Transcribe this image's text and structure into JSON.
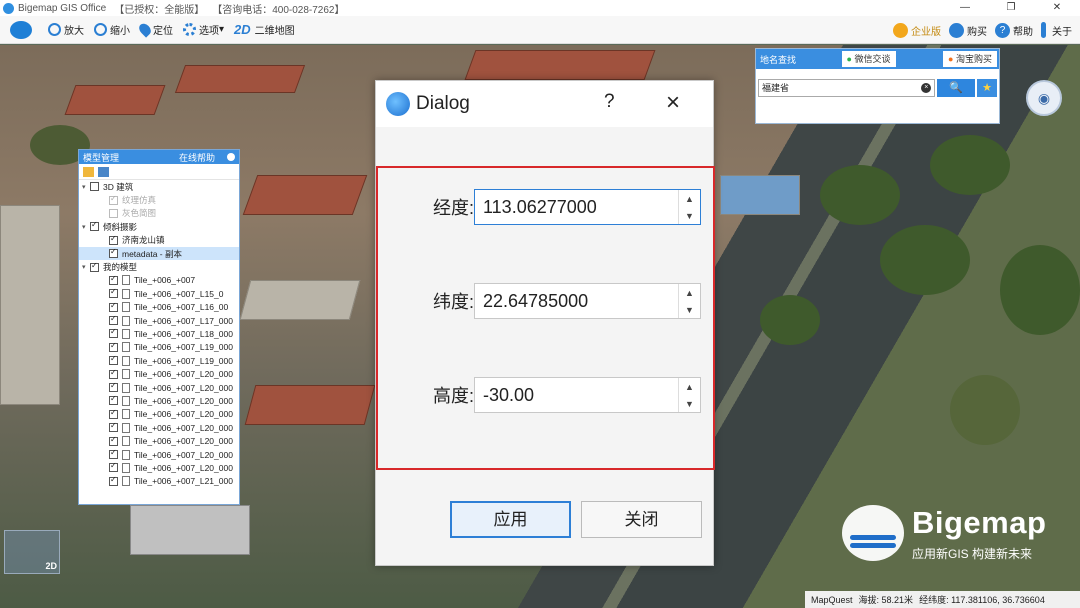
{
  "titlebar": {
    "app": "Bigemap GIS Office",
    "license": "【已授权：全能版】",
    "hotline": "【咨询电话：400-028-7262】"
  },
  "toolbar": {
    "zoom_in": "放大",
    "zoom_out": "缩小",
    "locate": "定位",
    "options": "选项",
    "mode_prefix": "2D",
    "mode": "二维地图",
    "enterprise": "企业版",
    "buy": "购买",
    "help": "帮助",
    "about": "关于"
  },
  "model_panel": {
    "title": "模型管理",
    "online_help": "在线帮助",
    "items": [
      {
        "label": "3D 建筑",
        "level": 0,
        "expanded": true,
        "checked": false,
        "disabled": false
      },
      {
        "label": "纹理仿真",
        "level": 1,
        "checked": true,
        "disabled": true
      },
      {
        "label": "灰色简图",
        "level": 1,
        "checked": false,
        "disabled": true
      },
      {
        "label": "倾斜摄影",
        "level": 0,
        "expanded": true,
        "checked": true,
        "disabled": false
      },
      {
        "label": "济南龙山镇",
        "level": 1,
        "checked": true,
        "disabled": false
      },
      {
        "label": "metadata - 副本",
        "level": 1,
        "checked": true,
        "disabled": false,
        "selected": true
      },
      {
        "label": "我的模型",
        "level": 0,
        "expanded": true,
        "checked": true,
        "disabled": false
      },
      {
        "label": "Tile_+006_+007",
        "level": 1,
        "checked": true,
        "file": true
      },
      {
        "label": "Tile_+006_+007_L15_0",
        "level": 1,
        "checked": true,
        "file": true
      },
      {
        "label": "Tile_+006_+007_L16_00",
        "level": 1,
        "checked": true,
        "file": true
      },
      {
        "label": "Tile_+006_+007_L17_000",
        "level": 1,
        "checked": true,
        "file": true
      },
      {
        "label": "Tile_+006_+007_L18_000",
        "level": 1,
        "checked": true,
        "file": true
      },
      {
        "label": "Tile_+006_+007_L19_000",
        "level": 1,
        "checked": true,
        "file": true
      },
      {
        "label": "Tile_+006_+007_L19_000",
        "level": 1,
        "checked": true,
        "file": true
      },
      {
        "label": "Tile_+006_+007_L20_000",
        "level": 1,
        "checked": true,
        "file": true
      },
      {
        "label": "Tile_+006_+007_L20_000",
        "level": 1,
        "checked": true,
        "file": true
      },
      {
        "label": "Tile_+006_+007_L20_000",
        "level": 1,
        "checked": true,
        "file": true
      },
      {
        "label": "Tile_+006_+007_L20_000",
        "level": 1,
        "checked": true,
        "file": true
      },
      {
        "label": "Tile_+006_+007_L20_000",
        "level": 1,
        "checked": true,
        "file": true
      },
      {
        "label": "Tile_+006_+007_L20_000",
        "level": 1,
        "checked": true,
        "file": true
      },
      {
        "label": "Tile_+006_+007_L20_000",
        "level": 1,
        "checked": true,
        "file": true
      },
      {
        "label": "Tile_+006_+007_L20_000",
        "level": 1,
        "checked": true,
        "file": true
      },
      {
        "label": "Tile_+006_+007_L21_000",
        "level": 1,
        "checked": true,
        "file": true
      }
    ]
  },
  "search_panel": {
    "title": "地名查找",
    "wechat": "微信交谈",
    "taobao": "淘宝购买",
    "query": "福建省",
    "clear": "×",
    "search_icon": "🔍",
    "favorite_icon": "★"
  },
  "dialog": {
    "title": "Dialog",
    "help": "?",
    "close": "×",
    "fields": {
      "longitude": {
        "label": "经度:",
        "value": "113.06277000"
      },
      "latitude": {
        "label": "纬度:",
        "value": "22.64785000"
      },
      "altitude": {
        "label": "高度:",
        "value": "-30.00"
      }
    },
    "apply": "应用",
    "close_btn": "关闭",
    "frame_color": "#d8282a"
  },
  "minimap": {
    "label": "2D"
  },
  "brand": {
    "name": "Bigemap",
    "slogan": "应用新GIS  构建新未来"
  },
  "statusbar": {
    "source": "MapQuest",
    "elevation": "海拔: 58.21米",
    "coords": "经纬度: 117.381106, 36.736604"
  },
  "colors": {
    "accent": "#2d7fd6",
    "panel_header": "#3a8ee0"
  }
}
